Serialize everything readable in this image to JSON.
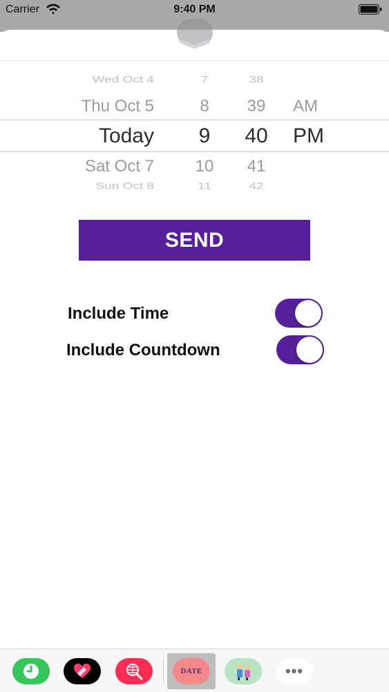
{
  "status_bar": {
    "carrier": "Carrier",
    "time": "9:40 PM"
  },
  "picker": {
    "rows": [
      {
        "date": "Wed Oct 4",
        "hour": "7",
        "minute": "38",
        "ampm": ""
      },
      {
        "date": "Thu Oct 5",
        "hour": "8",
        "minute": "39",
        "ampm": "AM"
      },
      {
        "date": "Today",
        "hour": "9",
        "minute": "40",
        "ampm": "PM"
      },
      {
        "date": "Sat Oct 7",
        "hour": "10",
        "minute": "41",
        "ampm": ""
      },
      {
        "date": "Sun Oct 8",
        "hour": "11",
        "minute": "42",
        "ampm": ""
      }
    ],
    "selected_index": 2
  },
  "send_label": "SEND",
  "options": [
    {
      "label": "Include Time",
      "on": true
    },
    {
      "label": "Include Countdown",
      "on": true
    }
  ],
  "app_drawer": {
    "apps": [
      {
        "icon": "clock-app-icon",
        "color": "#34c759"
      },
      {
        "icon": "heart-app-icon",
        "color": "#000000"
      },
      {
        "icon": "globe-search-app-icon",
        "color": "#ff2d55"
      },
      {
        "icon": "date-app-icon",
        "label": "DATE",
        "color": "#f4898b",
        "selected": true
      },
      {
        "icon": "sticker-app-icon",
        "color": "#b8e4c3"
      },
      {
        "icon": "more-icon",
        "label": "•••"
      }
    ]
  },
  "colors": {
    "accent": "#57209a",
    "status_bg": "#a9a9a9"
  }
}
